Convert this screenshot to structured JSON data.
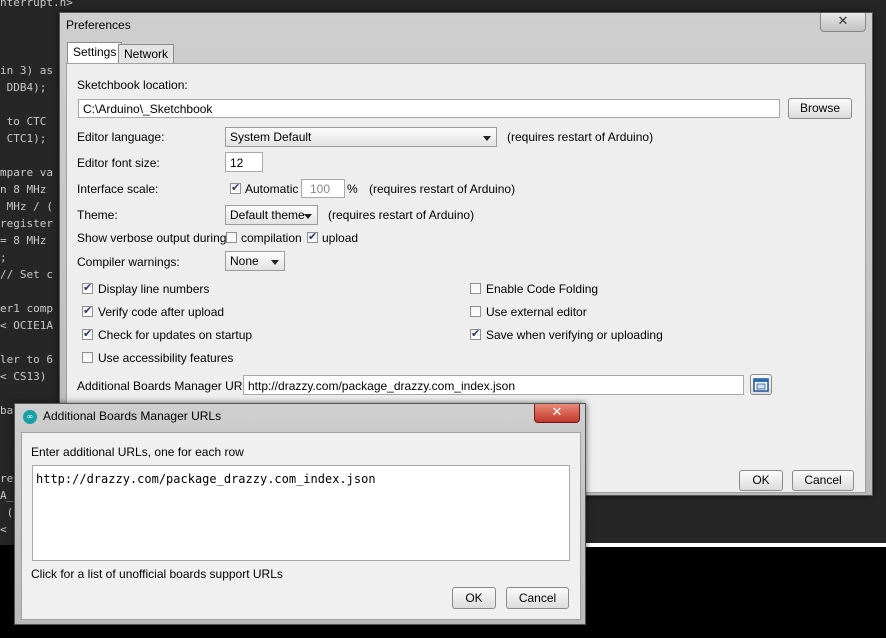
{
  "background_code": [
    "nterrupt.h>",
    "",
    "",
    "",
    "in 3) as",
    " DDB4);",
    "",
    " to CTC",
    " CTC1);",
    "",
    "mpare va",
    "n 8 MHz",
    " MHz / (",
    "register",
    "= 8 MHz",
    ";",
    "// Set c",
    "",
    "er1 comp",
    "< OCIE1A",
    "",
    "ler to 6",
    "< CS13)",
    "",
    "ba",
    "",
    "",
    "",
    "re",
    "A_",
    " (",
    "<"
  ],
  "preferences": {
    "title": "Preferences",
    "close": "✕",
    "tabs": [
      {
        "label": "Settings"
      },
      {
        "label": "Network"
      }
    ],
    "sketchbook_label": "Sketchbook location:",
    "sketchbook_value": "C:\\Arduino\\_Sketchbook",
    "browse_label": "Browse",
    "editor_language_label": "Editor language:",
    "editor_language_value": "System Default",
    "editor_language_note": "(requires restart of Arduino)",
    "font_size_label": "Editor font size:",
    "font_size_value": "12",
    "scale_label": "Interface scale:",
    "scale_auto_label": "Automatic",
    "scale_value": "100",
    "scale_unit": "%",
    "scale_note": "(requires restart of Arduino)",
    "theme_label": "Theme:",
    "theme_value": "Default theme",
    "theme_note": "(requires restart of Arduino)",
    "verbose_label": "Show verbose output during:",
    "verbose_compilation": "compilation",
    "verbose_upload": "upload",
    "warnings_label": "Compiler warnings:",
    "warnings_value": "None",
    "options_left": [
      {
        "label": "Display line numbers",
        "checked": true
      },
      {
        "label": "Verify code after upload",
        "checked": true
      },
      {
        "label": "Check for updates on startup",
        "checked": true
      },
      {
        "label": "Use accessibility features",
        "checked": false
      }
    ],
    "options_right": [
      {
        "label": "Enable Code Folding",
        "checked": false
      },
      {
        "label": "Use external editor",
        "checked": false
      },
      {
        "label": "Save when verifying or uploading",
        "checked": true
      }
    ],
    "boards_label": "Additional Boards Manager URLs:",
    "boards_value": "http://drazzy.com/package_drazzy.com_index.json",
    "ok_label": "OK",
    "cancel_label": "Cancel"
  },
  "boards_dialog": {
    "title": "Additional Boards Manager URLs",
    "close": "✕",
    "instruction": "Enter additional URLs, one for each row",
    "urls_text": "http://drazzy.com/package_drazzy.com_index.json",
    "link_text": "Click for a list of unofficial boards support URLs",
    "ok_label": "OK",
    "cancel_label": "Cancel"
  },
  "colors": {
    "accent": "#17a1a5",
    "close_red": "#c2392a"
  }
}
